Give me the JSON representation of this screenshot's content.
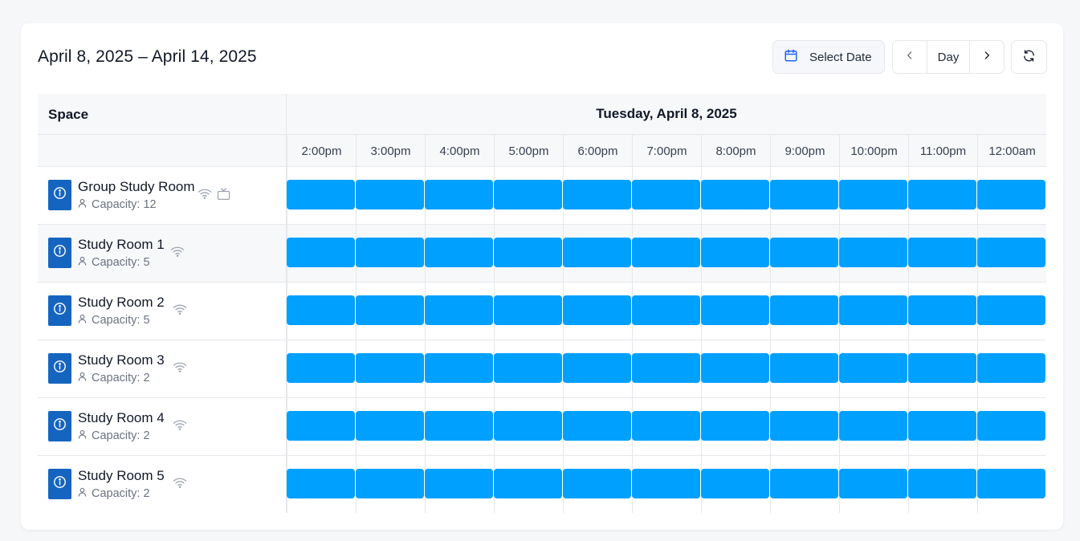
{
  "header": {
    "range_title": "April 8, 2025 – April 14, 2025",
    "select_date_label": "Select Date",
    "view_label": "Day",
    "icons": {
      "calendar": "calendar-icon",
      "prev": "chevron-left-icon",
      "next": "chevron-right-icon",
      "refresh": "refresh-icon"
    }
  },
  "grid": {
    "space_header": "Space",
    "day_header": "Tuesday, April 8, 2025",
    "times": [
      "2:00pm",
      "3:00pm",
      "4:00pm",
      "5:00pm",
      "6:00pm",
      "7:00pm",
      "8:00pm",
      "9:00pm",
      "10:00pm",
      "11:00pm",
      "12:00am"
    ],
    "slot_color": "#00a0ff"
  },
  "spaces": [
    {
      "name": "Group Study Room",
      "capacity": "Capacity: 12",
      "amenities": [
        "wifi-icon",
        "tv-icon"
      ]
    },
    {
      "name": "Study Room 1",
      "capacity": "Capacity: 5",
      "amenities": [
        "wifi-icon"
      ]
    },
    {
      "name": "Study Room 2",
      "capacity": "Capacity: 5",
      "amenities": [
        "wifi-icon"
      ]
    },
    {
      "name": "Study Room 3",
      "capacity": "Capacity: 2",
      "amenities": [
        "wifi-icon"
      ]
    },
    {
      "name": "Study Room 4",
      "capacity": "Capacity: 2",
      "amenities": [
        "wifi-icon"
      ]
    },
    {
      "name": "Study Room 5",
      "capacity": "Capacity: 2",
      "amenities": [
        "wifi-icon"
      ]
    }
  ]
}
